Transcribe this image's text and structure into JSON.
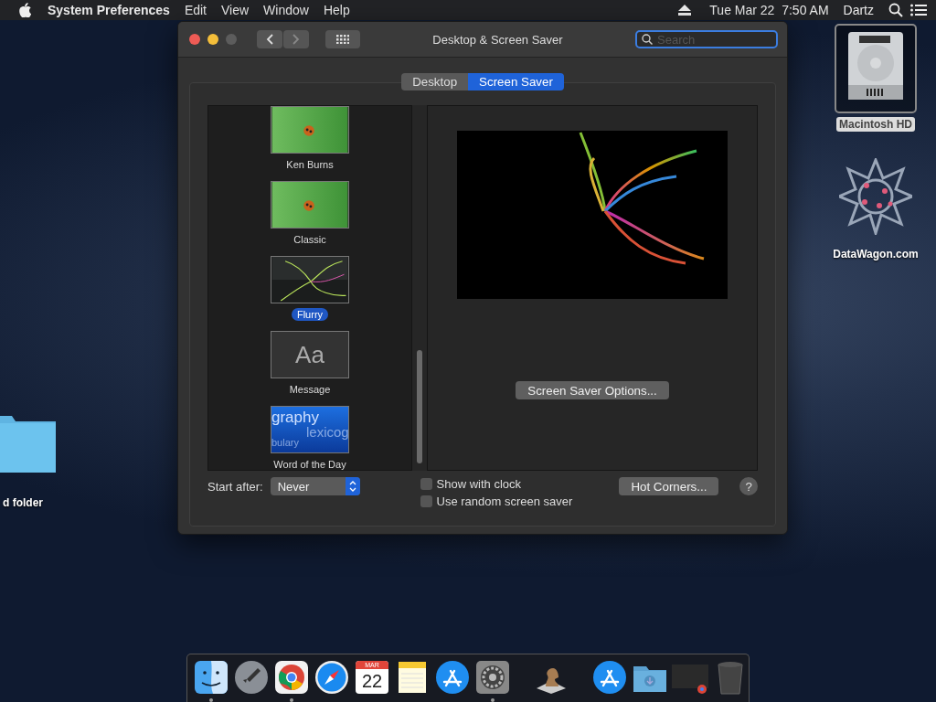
{
  "menubar": {
    "app": "System Preferences",
    "menus": [
      "Edit",
      "View",
      "Window",
      "Help"
    ],
    "clock": "Tue Mar 22  7:50 AM",
    "user": "Dartz"
  },
  "window": {
    "title": "Desktop & Screen Saver",
    "search": {
      "placeholder": "Search"
    },
    "tabs": [
      {
        "label": "Desktop",
        "selected": false
      },
      {
        "label": "Screen Saver",
        "selected": true
      }
    ],
    "savers": [
      {
        "name": "Ken Burns",
        "kind": "photo",
        "selected": false
      },
      {
        "name": "Classic",
        "kind": "photo",
        "selected": false
      },
      {
        "name": "Flurry",
        "kind": "flurry",
        "selected": true
      },
      {
        "name": "Message",
        "kind": "message",
        "thumb_text": [
          "Aa"
        ],
        "selected": false
      },
      {
        "name": "Word of the Day",
        "kind": "words",
        "thumb_text": [
          "graphy",
          "lexicog",
          "bulary"
        ],
        "selected": false
      }
    ],
    "options_button": "Screen Saver Options...",
    "start_after": {
      "label": "Start after:",
      "value": "Never"
    },
    "checkboxes": [
      {
        "label": "Show with clock",
        "checked": false
      },
      {
        "label": "Use random screen saver",
        "checked": false
      }
    ],
    "hot_corners_button": "Hot Corners...",
    "help_button": "?"
  },
  "desktop_icons": [
    {
      "label": "Macintosh HD",
      "kind": "disk",
      "selected": true
    },
    {
      "label": "DataWagon.com",
      "kind": "star",
      "selected": false
    },
    {
      "label": "d folder",
      "kind": "folder",
      "selected": false
    }
  ],
  "dock": {
    "apps": [
      {
        "kind": "finder",
        "running": true
      },
      {
        "kind": "launchpad",
        "running": false
      },
      {
        "kind": "chrome",
        "running": true
      },
      {
        "kind": "safari",
        "running": false
      },
      {
        "kind": "calendar",
        "month": "MAR",
        "day": "22",
        "running": false
      },
      {
        "kind": "notes",
        "running": false
      },
      {
        "kind": "appstore",
        "running": false
      },
      {
        "kind": "settings",
        "running": true
      },
      {
        "kind": "chess",
        "running": false
      }
    ],
    "others": [
      {
        "kind": "appstore"
      },
      {
        "kind": "folder"
      },
      {
        "kind": "window"
      },
      {
        "kind": "trash"
      }
    ]
  }
}
